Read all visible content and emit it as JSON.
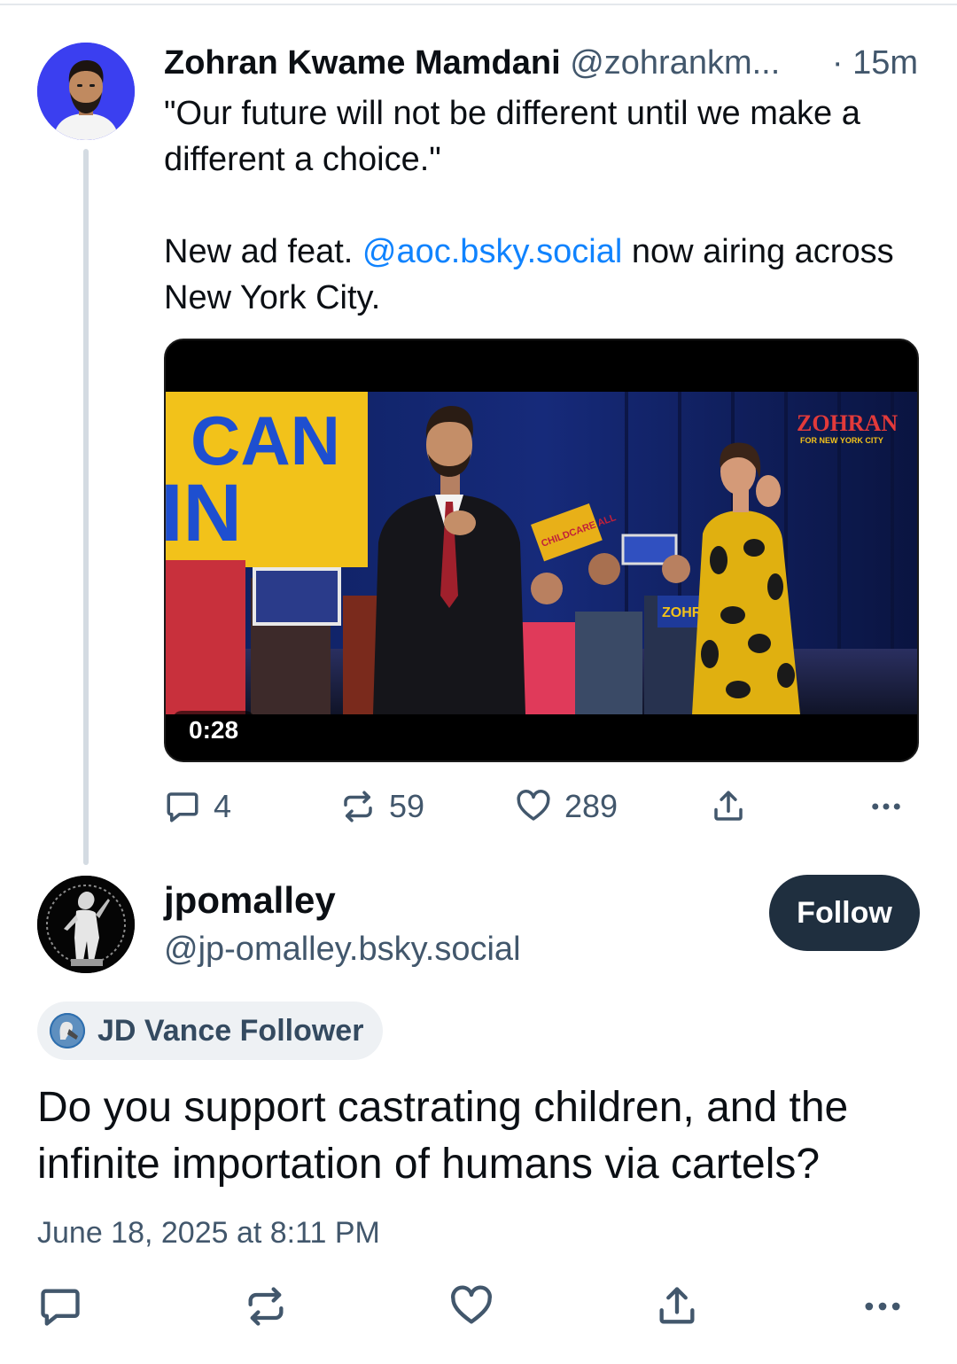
{
  "parent_post": {
    "author_name": "Zohran Kwame Mamdani",
    "author_handle": "@zohrankm...",
    "time": "· 15m",
    "text_line1": "\"Our future will not be different until we make a different a choice.\"",
    "text_pre_mention": "New ad feat. ",
    "mention": "@aoc.bsky.social",
    "text_post_mention": " now airing across New York City.",
    "video": {
      "duration": "0:28",
      "sign_text_1": "CAN",
      "sign_text_2": "IN",
      "watermark": "ZOHRAN",
      "watermark_sub": "FOR NEW YORK CITY",
      "crowd_sign": "CHILDCARE ALL",
      "crowd_sign_2": "ZOHR"
    },
    "counts": {
      "replies": "4",
      "reposts": "59",
      "likes": "289"
    }
  },
  "reply_post": {
    "author_name": "jpomalley",
    "author_handle": "@jp-omalley.bsky.social",
    "follow_label": "Follow",
    "badge_label": "JD Vance Follower",
    "text": "Do you support castrating children, and the infinite importation of humans via cartels?",
    "date": "June 18, 2025 at 8:11 PM"
  },
  "icons": {
    "reply": "speech-bubble-icon",
    "repost": "repost-arrows-icon",
    "like": "heart-icon",
    "share": "share-upload-icon",
    "more": "more-dots-icon"
  },
  "colors": {
    "link": "#1083fe",
    "muted": "#42576c",
    "follow_button": "#1f2f3f",
    "avatar_bg": "#3b3ff0"
  }
}
